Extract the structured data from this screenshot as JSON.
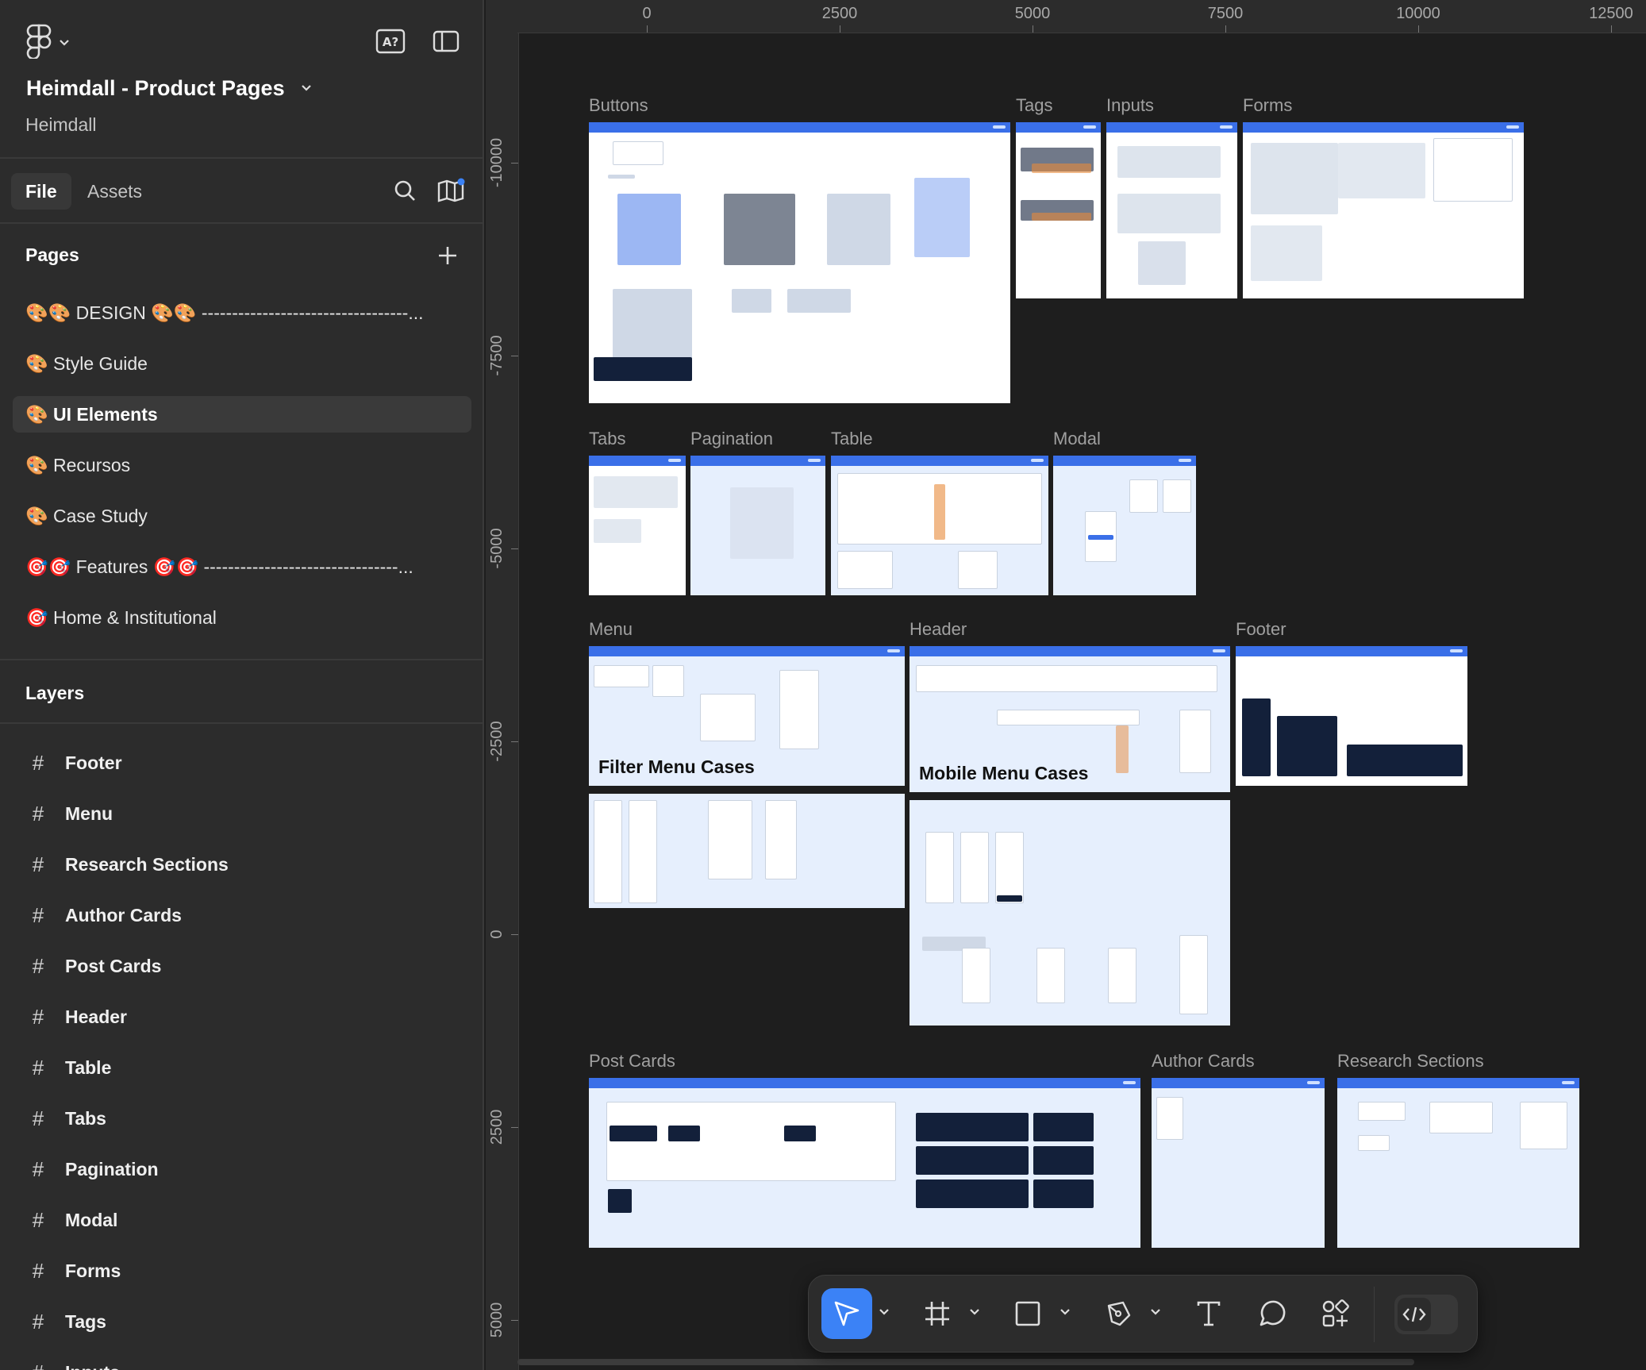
{
  "file": {
    "title": "Heimdall - Product Pages",
    "team": "Heimdall"
  },
  "tabs": {
    "file": "File",
    "assets": "Assets"
  },
  "pages": {
    "heading": "Pages",
    "items": [
      "🎨🎨 DESIGN 🎨🎨 ----------------------------------...",
      "🎨 Style Guide",
      "🎨 UI Elements",
      "🎨 Recursos",
      "🎨 Case Study",
      "🎯🎯 Features 🎯🎯 --------------------------------...",
      "🎯 Home & Institutional"
    ],
    "active_index": 2
  },
  "layers": {
    "heading": "Layers",
    "items": [
      "Footer",
      "Menu",
      "Research Sections",
      "Author Cards",
      "Post Cards",
      "Header",
      "Table",
      "Tabs",
      "Pagination",
      "Modal",
      "Forms",
      "Tags",
      "Inputs"
    ]
  },
  "ruler": {
    "top": [
      "0",
      "2500",
      "5000",
      "7500",
      "10000",
      "12500"
    ],
    "left": [
      "-10000",
      "-7500",
      "-5000",
      "-2500",
      "0",
      "2500",
      "5000"
    ]
  },
  "frames": {
    "buttons": "Buttons",
    "tags": "Tags",
    "inputs": "Inputs",
    "forms": "Forms",
    "tabs": "Tabs",
    "pagination": "Pagination",
    "table": "Table",
    "modal": "Modal",
    "menu": "Menu",
    "header": "Header",
    "footer": "Footer",
    "post_cards": "Post Cards",
    "author_cards": "Author Cards",
    "research_sections": "Research Sections",
    "filter_menu_cases": "Filter Menu Cases",
    "mobile_menu_cases": "Mobile Menu Cases"
  },
  "toolbar": {
    "tools": [
      "move-tool",
      "frame-tool",
      "shape-tool",
      "pen-tool",
      "text-tool",
      "comment-tool",
      "actions-tool"
    ],
    "active_tool": "move-tool",
    "dev_mode": "off"
  },
  "colors": {
    "accent": "#3b82f6",
    "frame_header": "#3a6fe8",
    "canvas_bg": "#1e1e1e",
    "panel_bg": "#2c2c2c"
  }
}
